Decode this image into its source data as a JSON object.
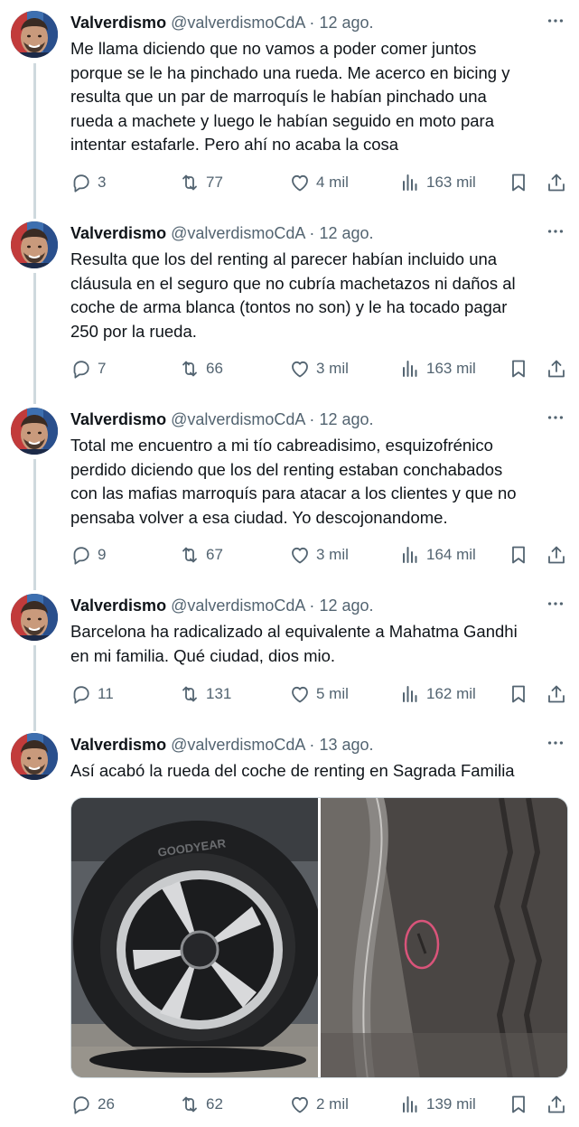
{
  "tweets": [
    {
      "name": "Valverdismo",
      "handle": "@valverdismoCdA",
      "separator": "·",
      "date": "12 ago.",
      "lines": [
        "Me llama diciendo que no vamos a poder comer juntos",
        "porque se le ha pinchado una rueda. Me acerco en bicing y",
        "resulta que un par de marroquís le habían pinchado una",
        "rueda a machete y luego le habían seguido en moto para",
        "intentar estafarle. Pero ahí no acaba la cosa"
      ],
      "replies": "3",
      "retweets": "77",
      "likes": "4 mil",
      "views": "163 mil"
    },
    {
      "name": "Valverdismo",
      "handle": "@valverdismoCdA",
      "separator": "·",
      "date": "12 ago.",
      "lines": [
        "Resulta que los del renting al parecer habían incluido una",
        "cláusula en el seguro que no cubría machetazos ni daños al",
        "coche de arma blanca (tontos no son) y le ha tocado pagar",
        "250 por la rueda."
      ],
      "replies": "7",
      "retweets": "66",
      "likes": "3 mil",
      "views": "163 mil"
    },
    {
      "name": "Valverdismo",
      "handle": "@valverdismoCdA",
      "separator": "·",
      "date": "12 ago.",
      "lines": [
        "Total me encuentro a mi tío cabreadisimo, esquizofrénico",
        "perdido diciendo que los del renting estaban conchabados",
        "con las mafias marroquís para atacar a los clientes y que no",
        "pensaba volver a esa ciudad. Yo descojonandome."
      ],
      "replies": "9",
      "retweets": "67",
      "likes": "3 mil",
      "views": "164 mil"
    },
    {
      "name": "Valverdismo",
      "handle": "@valverdismoCdA",
      "separator": "·",
      "date": "12 ago.",
      "lines": [
        "Barcelona ha radicalizado al equivalente a Mahatma Gandhi",
        "en mi familia. Qué ciudad, dios mio."
      ],
      "replies": "11",
      "retweets": "131",
      "likes": "5 mil",
      "views": "162 mil"
    },
    {
      "name": "Valverdismo",
      "handle": "@valverdismoCdA",
      "separator": "·",
      "date": "13 ago.",
      "lines": [
        "Así acabó la rueda del coche de renting en Sagrada Familia"
      ],
      "replies": "26",
      "retweets": "62",
      "likes": "2 mil",
      "views": "139 mil"
    }
  ],
  "media": {
    "tire_brand": "GOODYEAR"
  },
  "colors": {
    "text": "#0f1419",
    "muted": "#536471",
    "thread_line": "#cfd9de"
  },
  "icons": [
    "more-icon",
    "reply-icon",
    "retweet-icon",
    "like-icon",
    "views-icon",
    "bookmark-icon",
    "share-icon"
  ]
}
